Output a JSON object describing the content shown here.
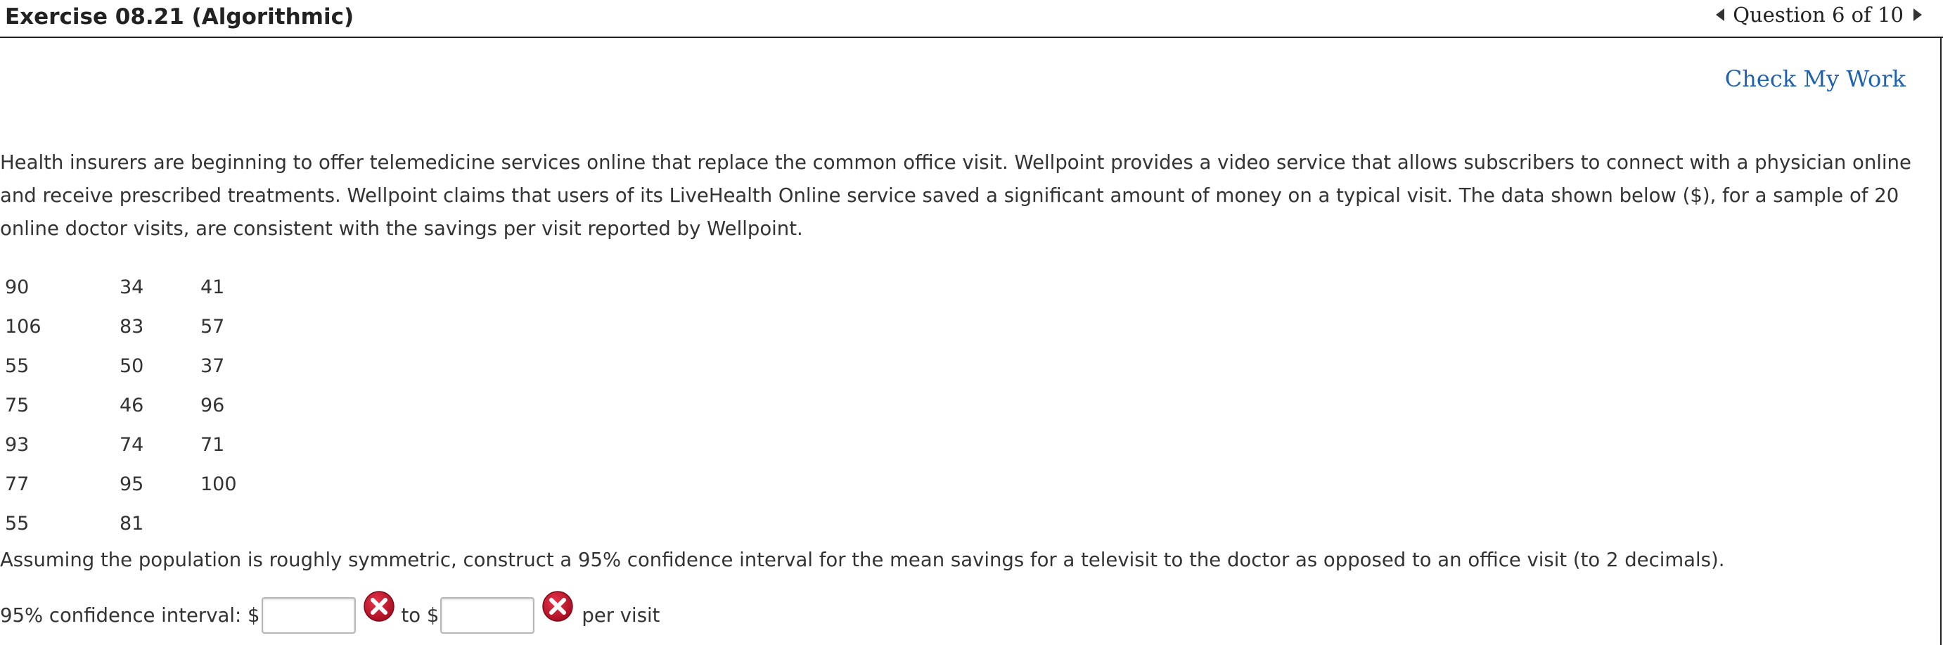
{
  "header": {
    "title": "Exercise 08.21 (Algorithmic)",
    "question_nav": "Question 6 of 10"
  },
  "check_work_label": "Check My Work",
  "question": {
    "intro": "Health insurers are beginning to offer telemedicine services online that replace the common office visit. Wellpoint provides a video service that allows subscribers to connect with a physician online and receive prescribed treatments. Wellpoint claims that users of its LiveHealth Online service saved a significant amount of money on a typical visit. The data shown below ($), for a sample of 20 online doctor visits, are consistent with the savings per visit reported by Wellpoint.",
    "data_rows": [
      [
        "90",
        "34",
        "41"
      ],
      [
        "106",
        "83",
        "57"
      ],
      [
        "55",
        "50",
        "37"
      ],
      [
        "75",
        "46",
        "96"
      ],
      [
        "93",
        "74",
        "71"
      ],
      [
        "77",
        "95",
        "100"
      ],
      [
        "55",
        "81",
        ""
      ]
    ],
    "instruction": "Assuming the population is roughly symmetric, construct a 95% confidence interval for the mean savings for a televisit to the doctor as opposed to an office visit (to 2 decimals).",
    "answer_label": "95% confidence interval: $",
    "to_label": "to $",
    "unit_label": "per visit",
    "lower_value": "",
    "upper_value": ""
  },
  "colors": {
    "link": "#1f63b0",
    "incorrect": "#c8102e"
  },
  "icons": {
    "prev": "triangle-left-icon",
    "next": "triangle-right-icon",
    "incorrect": "incorrect-x-icon"
  }
}
